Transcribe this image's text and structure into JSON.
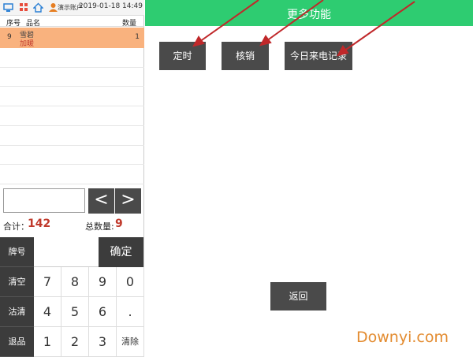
{
  "topbar": {
    "icons": [
      "screen-icon",
      "grid-icon",
      "home-icon",
      "user-icon"
    ],
    "account": "演示账户",
    "datetime": "2019-01-18 14:49"
  },
  "list": {
    "headers": {
      "no": "序号",
      "name": "品名",
      "qty": "数量"
    },
    "rows": [
      {
        "no": "9",
        "name": "雪碧",
        "note": "加暖",
        "qty": "1",
        "selected": true
      }
    ],
    "selected_color": "#f9b27e"
  },
  "nav": {
    "prev": "<",
    "next": ">"
  },
  "summary": {
    "total_label": "合计：",
    "total_value": "142",
    "count_label": "总数量:",
    "count_value": "9",
    "value_color": "#c0392b"
  },
  "keypad": {
    "side": {
      "pai": "牌号",
      "clear": "清空",
      "jieqing": "沽清",
      "tuipin": "退品"
    },
    "confirm": "确定",
    "keys": [
      [
        "7",
        "8",
        "9",
        "0"
      ],
      [
        "4",
        "5",
        "6",
        "."
      ],
      [
        "1",
        "2",
        "3",
        "清除"
      ]
    ]
  },
  "header": {
    "title": "更多功能",
    "color": "#2ecc71"
  },
  "actions": {
    "timer": "定时",
    "verify": "核销",
    "calls": "今日来电记录",
    "back": "返回"
  },
  "watermark": "Downyi.com"
}
